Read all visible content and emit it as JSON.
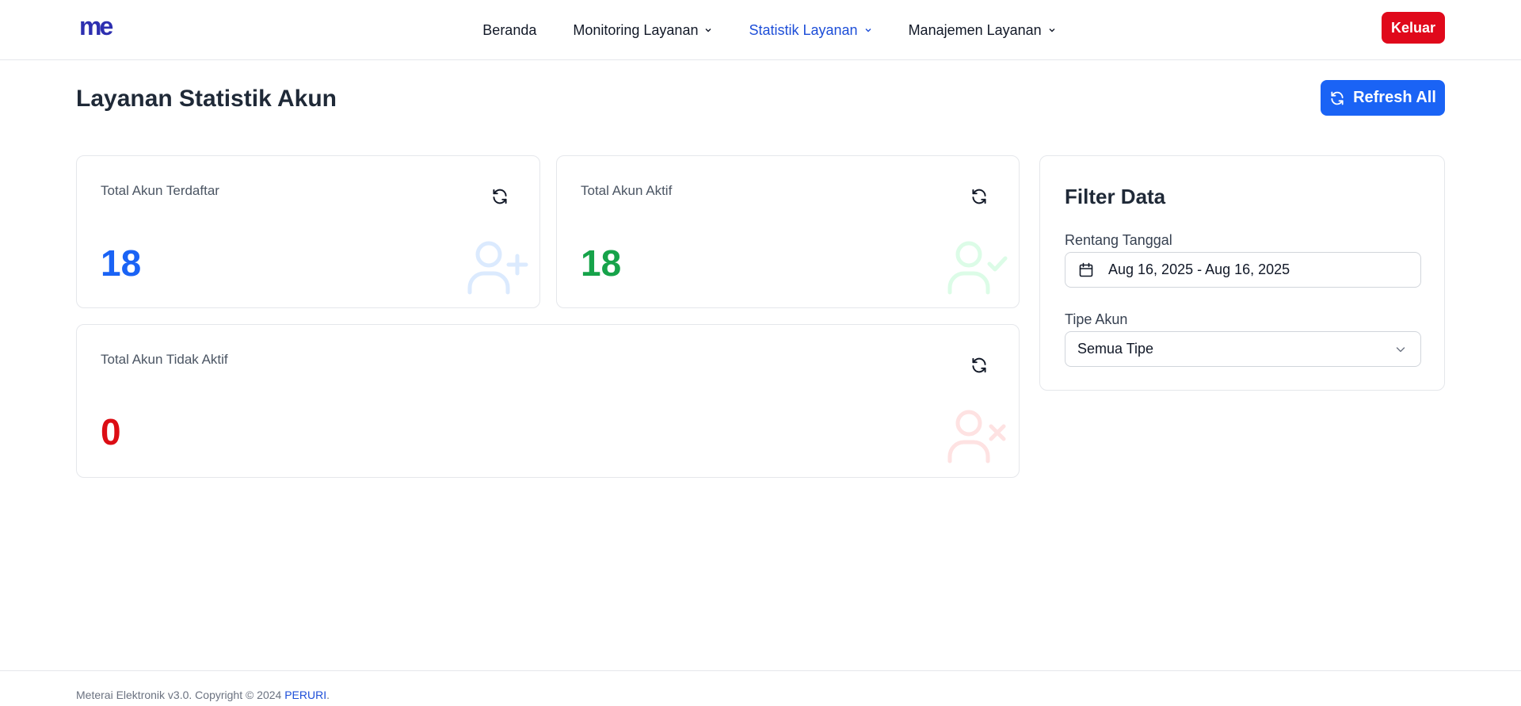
{
  "nav": {
    "logo_alt": "me",
    "items": [
      {
        "label": "Beranda",
        "has_dropdown": false,
        "active": false
      },
      {
        "label": "Monitoring Layanan",
        "has_dropdown": true,
        "active": false
      },
      {
        "label": "Statistik Layanan",
        "has_dropdown": true,
        "active": true
      },
      {
        "label": "Manajemen Layanan",
        "has_dropdown": true,
        "active": false
      }
    ],
    "logout_label": "Keluar"
  },
  "page": {
    "title": "Layanan Statistik Akun",
    "refresh_all_label": "Refresh All"
  },
  "cards": {
    "registered": {
      "title": "Total Akun Terdaftar",
      "value": "18",
      "color": "#1a63f5",
      "icon": "user-plus-icon"
    },
    "active": {
      "title": "Total Akun Aktif",
      "value": "18",
      "color": "#16a34a",
      "icon": "user-check-icon"
    },
    "inactive": {
      "title": "Total Akun Tidak Aktif",
      "value": "0",
      "color": "#dc0d14",
      "icon": "user-x-icon"
    }
  },
  "filter": {
    "title": "Filter Data",
    "date_range_label": "Rentang Tanggal",
    "date_range_value": "Aug 16, 2025 - Aug 16, 2025",
    "account_type_label": "Tipe Akun",
    "account_type_value": "Semua Tipe"
  },
  "footer": {
    "text": "Meterai Elektronik v3.0. Copyright © 2024 ",
    "link": "PERURI",
    "suffix": "."
  },
  "colors": {
    "brand_blue": "#1a63f5",
    "logout_red": "#e0091b",
    "active_nav": "#1d4ed8"
  }
}
